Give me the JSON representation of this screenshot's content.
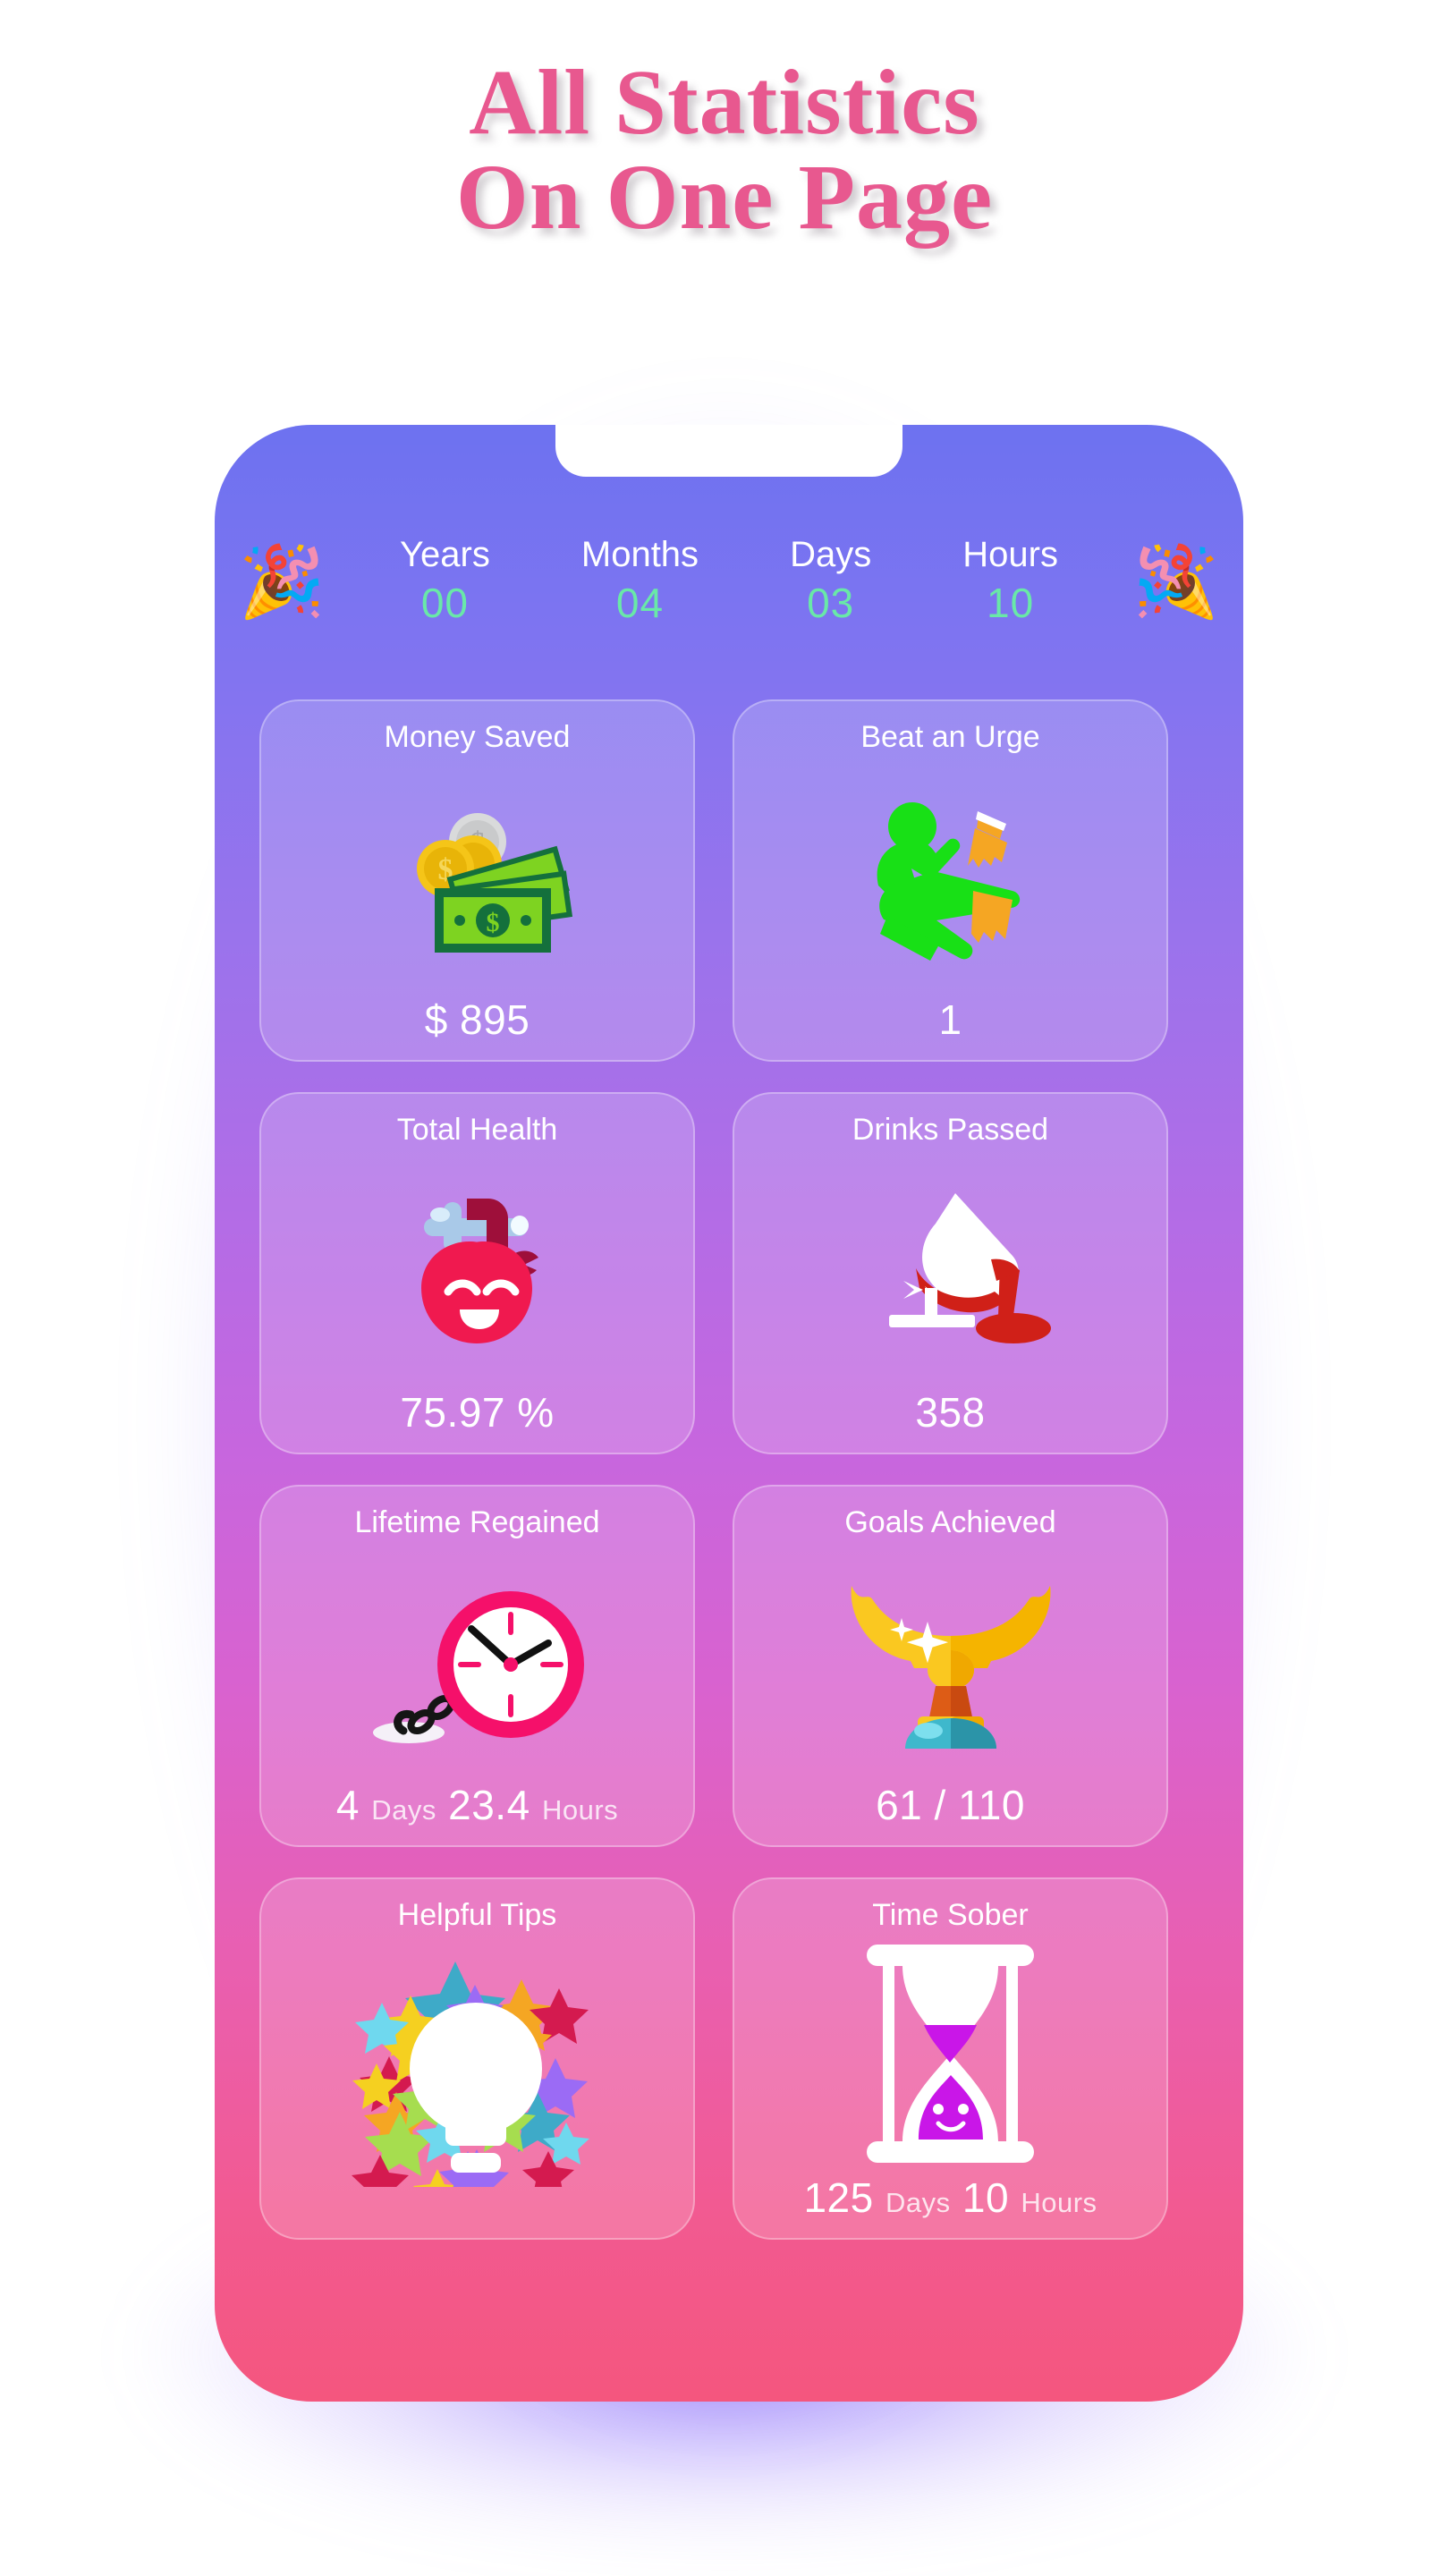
{
  "headline": {
    "line1": "All Statistics",
    "line2": "On One Page",
    "color": "#e8588f"
  },
  "counter": {
    "left_icon": "party-popper-icon",
    "right_icon": "party-popper-icon",
    "value_color": "#69e8a8",
    "units": [
      {
        "label": "Years",
        "value": "00"
      },
      {
        "label": "Months",
        "value": "04"
      },
      {
        "label": "Days",
        "value": "03"
      },
      {
        "label": "Hours",
        "value": "10"
      }
    ]
  },
  "cards": [
    {
      "title": "Money Saved",
      "icon": "money-banknotes-icon",
      "value": "$ 895"
    },
    {
      "title": "Beat an Urge",
      "icon": "karate-kick-icon",
      "value": "1"
    },
    {
      "title": "Total Health",
      "icon": "smiling-heart-apple-icon",
      "value": "75.97 %"
    },
    {
      "title": "Drinks Passed",
      "icon": "spilled-wine-glass-icon",
      "value": "358"
    },
    {
      "title": "Lifetime Regained",
      "icon": "clock-ball-chain-icon",
      "value_num1": "4",
      "value_unit1": "Days",
      "value_num2": "23.4",
      "value_unit2": "Hours"
    },
    {
      "title": "Goals Achieved",
      "icon": "gold-trophy-icon",
      "value": "61 / 110"
    },
    {
      "title": "Helpful Tips",
      "icon": "lightbulb-stars-icon",
      "value": ""
    },
    {
      "title": "Time Sober",
      "icon": "hourglass-icon",
      "value_num1": "125",
      "value_unit1": "Days",
      "value_num2": "10",
      "value_unit2": "Hours"
    }
  ]
}
